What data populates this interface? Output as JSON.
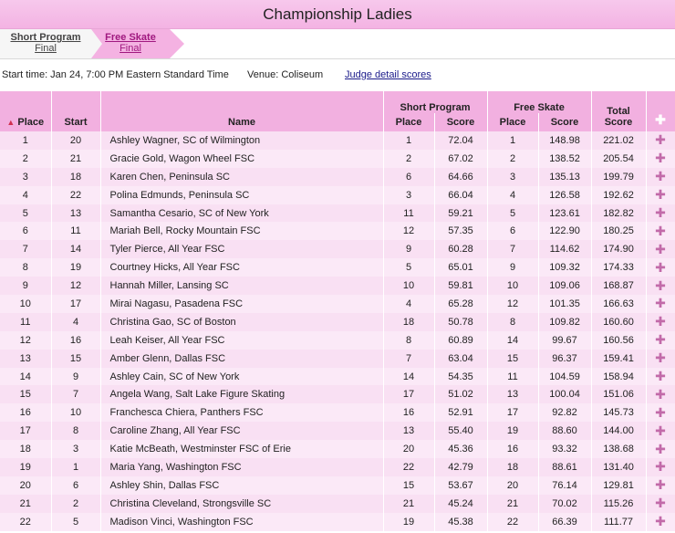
{
  "title": "Championship Ladies",
  "breadcrumbs": [
    {
      "label": "Short Program",
      "sub": "Final"
    },
    {
      "label": "Free Skate",
      "sub": "Final"
    }
  ],
  "info": {
    "start_time": "Start time: Jan 24, 7:00 PM Eastern Standard Time",
    "venue": "Venue: Coliseum",
    "judge_link": "Judge detail scores"
  },
  "columns": {
    "place": "Place",
    "start": "Start",
    "name": "Name",
    "short_program": "Short Program",
    "free_skate": "Free Skate",
    "place_sub": "Place",
    "score_sub": "Score",
    "total_score_line1": "Total",
    "total_score_line2": "Score"
  },
  "rows": [
    {
      "place": "1",
      "start": "20",
      "name": "Ashley Wagner, SC of Wilmington",
      "sp_place": "1",
      "sp_score": "72.04",
      "fs_place": "1",
      "fs_score": "148.98",
      "total": "221.02"
    },
    {
      "place": "2",
      "start": "21",
      "name": "Gracie Gold, Wagon Wheel FSC",
      "sp_place": "2",
      "sp_score": "67.02",
      "fs_place": "2",
      "fs_score": "138.52",
      "total": "205.54"
    },
    {
      "place": "3",
      "start": "18",
      "name": "Karen Chen, Peninsula SC",
      "sp_place": "6",
      "sp_score": "64.66",
      "fs_place": "3",
      "fs_score": "135.13",
      "total": "199.79"
    },
    {
      "place": "4",
      "start": "22",
      "name": "Polina Edmunds, Peninsula SC",
      "sp_place": "3",
      "sp_score": "66.04",
      "fs_place": "4",
      "fs_score": "126.58",
      "total": "192.62"
    },
    {
      "place": "5",
      "start": "13",
      "name": "Samantha Cesario, SC of New York",
      "sp_place": "11",
      "sp_score": "59.21",
      "fs_place": "5",
      "fs_score": "123.61",
      "total": "182.82"
    },
    {
      "place": "6",
      "start": "11",
      "name": "Mariah Bell, Rocky Mountain FSC",
      "sp_place": "12",
      "sp_score": "57.35",
      "fs_place": "6",
      "fs_score": "122.90",
      "total": "180.25"
    },
    {
      "place": "7",
      "start": "14",
      "name": "Tyler Pierce, All Year FSC",
      "sp_place": "9",
      "sp_score": "60.28",
      "fs_place": "7",
      "fs_score": "114.62",
      "total": "174.90"
    },
    {
      "place": "8",
      "start": "19",
      "name": "Courtney Hicks, All Year FSC",
      "sp_place": "5",
      "sp_score": "65.01",
      "fs_place": "9",
      "fs_score": "109.32",
      "total": "174.33"
    },
    {
      "place": "9",
      "start": "12",
      "name": "Hannah Miller, Lansing SC",
      "sp_place": "10",
      "sp_score": "59.81",
      "fs_place": "10",
      "fs_score": "109.06",
      "total": "168.87"
    },
    {
      "place": "10",
      "start": "17",
      "name": "Mirai Nagasu, Pasadena FSC",
      "sp_place": "4",
      "sp_score": "65.28",
      "fs_place": "12",
      "fs_score": "101.35",
      "total": "166.63"
    },
    {
      "place": "11",
      "start": "4",
      "name": "Christina Gao, SC of Boston",
      "sp_place": "18",
      "sp_score": "50.78",
      "fs_place": "8",
      "fs_score": "109.82",
      "total": "160.60"
    },
    {
      "place": "12",
      "start": "16",
      "name": "Leah Keiser, All Year FSC",
      "sp_place": "8",
      "sp_score": "60.89",
      "fs_place": "14",
      "fs_score": "99.67",
      "total": "160.56"
    },
    {
      "place": "13",
      "start": "15",
      "name": "Amber Glenn, Dallas FSC",
      "sp_place": "7",
      "sp_score": "63.04",
      "fs_place": "15",
      "fs_score": "96.37",
      "total": "159.41"
    },
    {
      "place": "14",
      "start": "9",
      "name": "Ashley Cain, SC of New York",
      "sp_place": "14",
      "sp_score": "54.35",
      "fs_place": "11",
      "fs_score": "104.59",
      "total": "158.94"
    },
    {
      "place": "15",
      "start": "7",
      "name": "Angela Wang, Salt Lake Figure Skating",
      "sp_place": "17",
      "sp_score": "51.02",
      "fs_place": "13",
      "fs_score": "100.04",
      "total": "151.06"
    },
    {
      "place": "16",
      "start": "10",
      "name": "Franchesca Chiera, Panthers FSC",
      "sp_place": "16",
      "sp_score": "52.91",
      "fs_place": "17",
      "fs_score": "92.82",
      "total": "145.73"
    },
    {
      "place": "17",
      "start": "8",
      "name": "Caroline Zhang, All Year FSC",
      "sp_place": "13",
      "sp_score": "55.40",
      "fs_place": "19",
      "fs_score": "88.60",
      "total": "144.00"
    },
    {
      "place": "18",
      "start": "3",
      "name": "Katie McBeath, Westminster FSC of Erie",
      "sp_place": "20",
      "sp_score": "45.36",
      "fs_place": "16",
      "fs_score": "93.32",
      "total": "138.68"
    },
    {
      "place": "19",
      "start": "1",
      "name": "Maria Yang, Washington FSC",
      "sp_place": "22",
      "sp_score": "42.79",
      "fs_place": "18",
      "fs_score": "88.61",
      "total": "131.40"
    },
    {
      "place": "20",
      "start": "6",
      "name": "Ashley Shin, Dallas FSC",
      "sp_place": "15",
      "sp_score": "53.67",
      "fs_place": "20",
      "fs_score": "76.14",
      "total": "129.81"
    },
    {
      "place": "21",
      "start": "2",
      "name": "Christina Cleveland, Strongsville SC",
      "sp_place": "21",
      "sp_score": "45.24",
      "fs_place": "21",
      "fs_score": "70.02",
      "total": "115.26"
    },
    {
      "place": "22",
      "start": "5",
      "name": "Madison Vinci, Washington FSC",
      "sp_place": "19",
      "sp_score": "45.38",
      "fs_place": "22",
      "fs_score": "66.39",
      "total": "111.77"
    }
  ],
  "icons": {
    "sort": "sort-arrows-icon",
    "expand": "plus-icon"
  },
  "colors": {
    "header": "#f2b0e0",
    "row_odd": "#f9e0f3",
    "row_even": "#fbe9f7",
    "accent": "#a0187f"
  }
}
